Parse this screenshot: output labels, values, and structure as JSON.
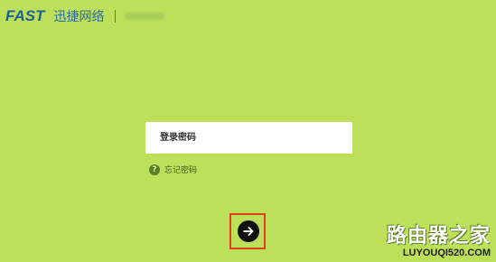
{
  "header": {
    "logo": "FAST",
    "brand_name": "迅捷网络",
    "model_name_obscured": ""
  },
  "login": {
    "password_placeholder": "登录密码",
    "password_value": "",
    "forgot_label": "忘记密码",
    "help_icon_glyph": "?",
    "submit_icon": "arrow-right-icon"
  },
  "watermark": {
    "cn": "路由器之家",
    "url": "LUYOUQI520.COM"
  },
  "colors": {
    "background": "#bde05a",
    "brand_blue": "#1f5f93",
    "highlight_border": "#e2401a",
    "button_black": "#101010"
  }
}
